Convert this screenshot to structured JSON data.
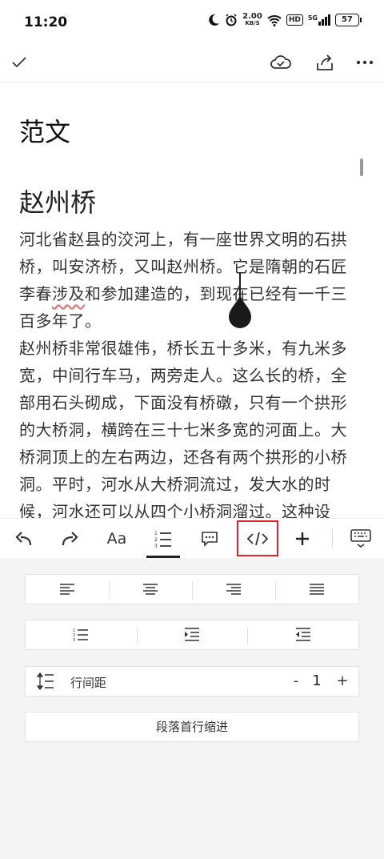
{
  "status_bar": {
    "time": "11:20",
    "net_speed": "2.00",
    "net_speed_unit": "KB/S",
    "hd": "HD",
    "signal": "5G",
    "battery": "57"
  },
  "document": {
    "title": "范文",
    "heading": "赵州桥",
    "para1_before": "河北省赵县的洨河上，有一座世界文明的石拱桥，叫安济桥，又叫赵州桥。它是隋朝的石匠李春",
    "para1_flagged": "涉及",
    "para1_after": "和参加建造的，到现在已经有一千三百多年了。",
    "para2": "赵州桥非常很雄伟，桥长五十多米，有九米多宽，中间行车马，两旁走人。这么长的桥，全部用石头砌成，下面没有桥礅，只有一个拱形的大桥洞，横跨在三十七米多宽的河面上。大桥洞顶上的左右两边，还各有两个拱形的小桥洞。平时，河水从大桥洞流过，发大水的时候，河水还可以从四个小桥洞溜过。这种设"
  },
  "toolbar": {
    "font_label": "Aa",
    "active_tool": "paragraph",
    "highlight_color": "#e3242b"
  },
  "panel": {
    "line_spacing_label": "行间距",
    "line_spacing_minus": "-",
    "line_spacing_value": "1",
    "line_spacing_plus": "+",
    "first_line_indent_label": "段落首行缩进"
  }
}
